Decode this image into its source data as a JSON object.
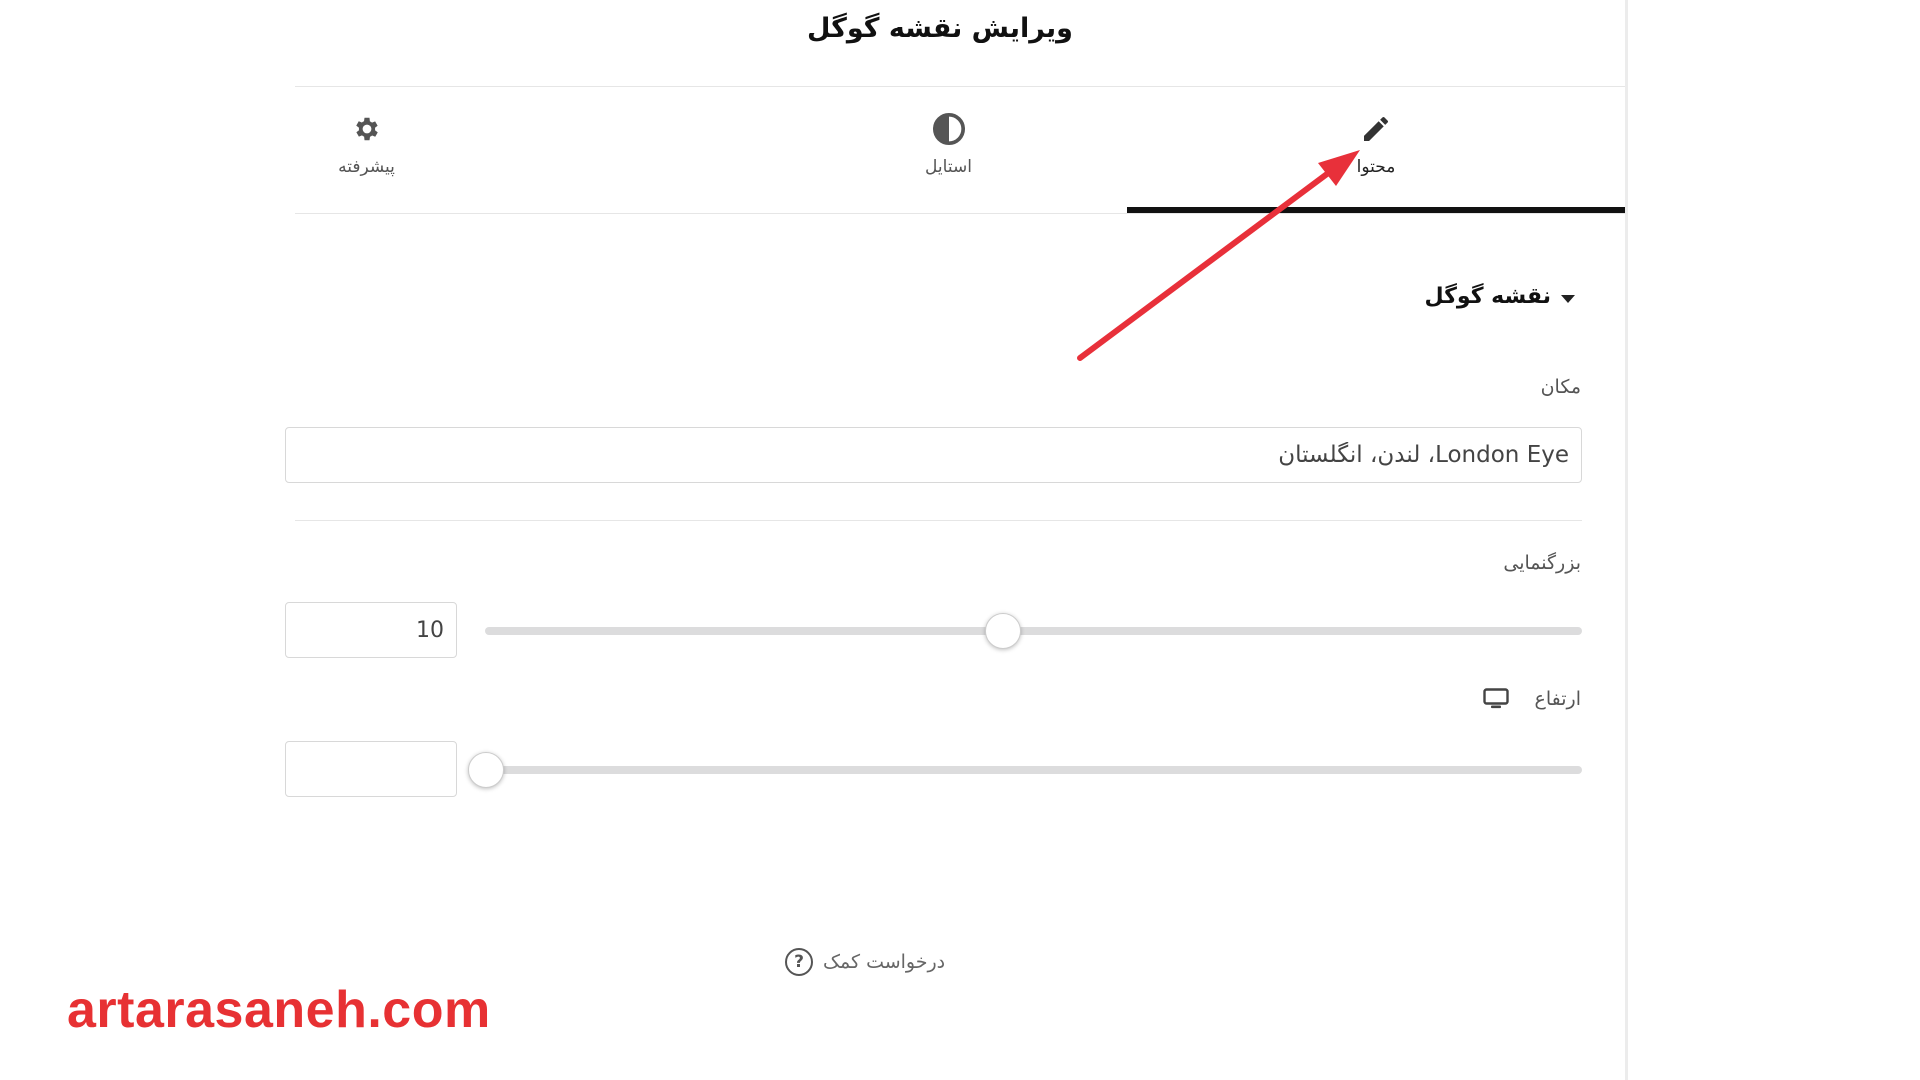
{
  "header": {
    "title": "ویرایش نقشه گوگل"
  },
  "tabs": [
    {
      "label": "محتوا",
      "icon": "pencil-icon",
      "active": true
    },
    {
      "label": "استایل",
      "icon": "contrast-icon",
      "active": false
    },
    {
      "label": "پیشرفته",
      "icon": "gear-icon",
      "active": false
    }
  ],
  "section": {
    "title": "نقشه گوگل",
    "expanded": true
  },
  "location": {
    "label": "مکان",
    "value": "London Eye، لندن، انگلستان"
  },
  "zoom": {
    "label": "بزرگنمایی",
    "value": "10",
    "level": 10,
    "min": 1,
    "max": 20
  },
  "height": {
    "label": "ارتفاع",
    "device_icon": "desktop-monitor-icon",
    "value": "",
    "level": 0
  },
  "help": {
    "label": "درخواست کمک",
    "icon": "question-circle-icon"
  },
  "watermark": {
    "text": "artarasaneh.com"
  },
  "colors": {
    "accent": "#111111",
    "watermark": "#e73133",
    "annotation": "#e8303a",
    "track": "#dcdcdd"
  }
}
